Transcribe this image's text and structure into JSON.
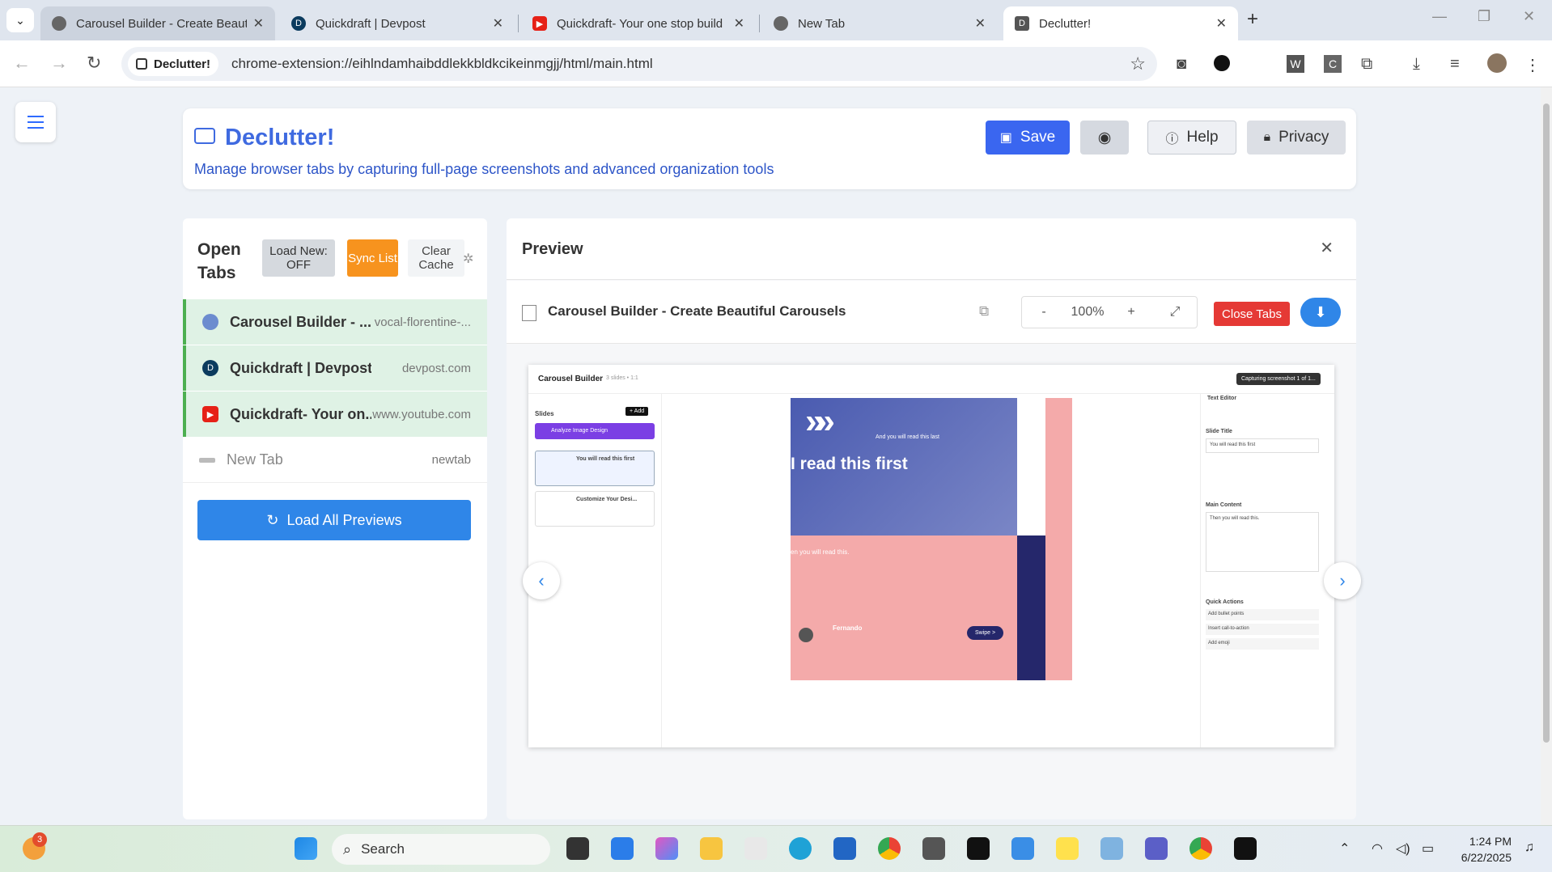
{
  "browser": {
    "tabs": [
      {
        "title": "Carousel Builder - Create Beaut",
        "favicon_color": "#666"
      },
      {
        "title": "Quickdraft | Devpost",
        "favicon_color": "#0b3b5e"
      },
      {
        "title": "Quickdraft- Your one stop build",
        "favicon_color": "#e62117"
      },
      {
        "title": "New Tab",
        "favicon_color": "#666"
      },
      {
        "title": "Declutter!",
        "favicon_color": "#555"
      }
    ],
    "new_tab_label": "+",
    "omnibox": {
      "chip": "Declutter!",
      "url": "chrome-extension://eihlndamhaibddlekkbldkcikeinmgjj/html/main.html"
    }
  },
  "app": {
    "title": "Declutter!",
    "subtitle": "Manage browser tabs by capturing full-page screenshots and advanced organization tools",
    "buttons": {
      "save": "Save",
      "help": "Help",
      "privacy": "Privacy"
    }
  },
  "open_tabs": {
    "heading": "Open Tabs",
    "load_new": "Load New: OFF",
    "sync": "Sync List",
    "clear_cache": "Clear Cache",
    "items": [
      {
        "title": "Carousel Builder - ...",
        "domain": "vocal-florentine-...",
        "favicon_color": "#6c8ccf"
      },
      {
        "title": "Quickdraft | Devpost",
        "domain": "devpost.com",
        "favicon_color": "#0b3b5e"
      },
      {
        "title": "Quickdraft- Your on...",
        "domain": "www.youtube.com",
        "favicon_color": "#e62117"
      },
      {
        "title": "New Tab",
        "domain": "newtab",
        "favicon_color": "#bbb"
      }
    ],
    "load_all": "Load All Previews"
  },
  "preview": {
    "heading": "Preview",
    "page_title": "Carousel Builder - Create Beautiful Carousels",
    "zoom_minus": "-",
    "zoom": "100%",
    "zoom_plus": "+",
    "close_tabs": "Close Tabs",
    "screenshot": {
      "app_title": "Carousel Builder",
      "meta": "3 slides • 1:1",
      "tooltip": "Capturing screenshot 1 of 1...",
      "slides_label": "Slides",
      "add_label": "+ Add",
      "analyze": "Analyze Image Design",
      "slide1": "You will read this first",
      "slide2": "Customize Your Desi...",
      "canvas_big": "I read this first",
      "canvas_top": "And you will read this last",
      "canvas_mid": "en you will read this.",
      "name": "Fernando",
      "swipe": "Swipe >",
      "editor_title": "Text Editor",
      "slide_title_label": "Slide Title",
      "slide_title_value": "You will read this first",
      "main_content_label": "Main Content",
      "main_content_value": "Then you will read this.",
      "quick_actions": "Quick Actions",
      "qa1": "Add bullet points",
      "qa2": "Insert call-to-action",
      "qa3": "Add emoji"
    }
  },
  "taskbar": {
    "search": "Search",
    "time": "1:24 PM",
    "date": "6/22/2025",
    "badge": "3"
  }
}
